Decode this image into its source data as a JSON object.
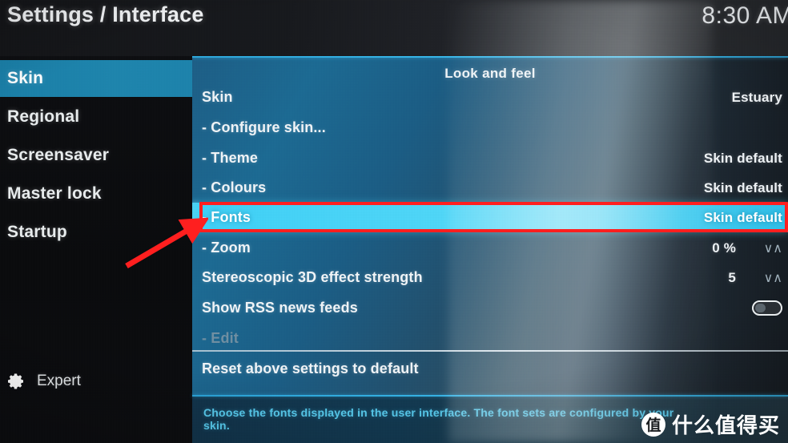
{
  "header": {
    "title": "Settings / Interface",
    "clock": "8:30 AM"
  },
  "sidebar": {
    "items": [
      {
        "label": "Skin",
        "selected": true
      },
      {
        "label": "Regional",
        "selected": false
      },
      {
        "label": "Screensaver",
        "selected": false
      },
      {
        "label": "Master lock",
        "selected": false
      },
      {
        "label": "Startup",
        "selected": false
      }
    ],
    "level": {
      "icon": "gear-icon",
      "label": "Expert"
    }
  },
  "main": {
    "section_title": "Look and feel",
    "rows": [
      {
        "label": "Skin",
        "value": "Estuary",
        "control": "value",
        "selected": false,
        "dim": false
      },
      {
        "label": "- Configure skin...",
        "value": "",
        "control": "none",
        "selected": false,
        "dim": false
      },
      {
        "label": "- Theme",
        "value": "Skin default",
        "control": "value",
        "selected": false,
        "dim": false
      },
      {
        "label": "- Colours",
        "value": "Skin default",
        "control": "value",
        "selected": false,
        "dim": false
      },
      {
        "label": "- Fonts",
        "value": "Skin default",
        "control": "value",
        "selected": true,
        "dim": false
      },
      {
        "label": "- Zoom",
        "value": "0 %",
        "control": "spinner",
        "selected": false,
        "dim": false
      },
      {
        "label": "Stereoscopic 3D effect strength",
        "value": "5",
        "control": "spinner",
        "selected": false,
        "dim": false
      },
      {
        "label": "Show RSS news feeds",
        "value": "",
        "control": "toggle",
        "selected": false,
        "dim": false,
        "toggle_on": false
      },
      {
        "label": "- Edit",
        "value": "",
        "control": "none",
        "selected": false,
        "dim": true
      },
      {
        "label": "Reset above settings to default",
        "value": "",
        "control": "none",
        "selected": false,
        "dim": false
      }
    ],
    "spinner_glyph": "∨∧"
  },
  "footer": {
    "help": "Choose the fonts displayed in the user interface. The font sets are configured by your skin."
  },
  "watermark": {
    "mark": "值",
    "text": "什么值得买"
  },
  "annotation": {
    "box_target": "- Fonts",
    "arrow": "red-arrow-pointing-to-fonts-row"
  },
  "colors": {
    "highlight_row": "#4fd6f7",
    "sidebar_selected": "#1e85ad",
    "accent_line": "#37b6e8",
    "help_text": "#58cdf0",
    "annotation_red": "#ff1f1f"
  }
}
